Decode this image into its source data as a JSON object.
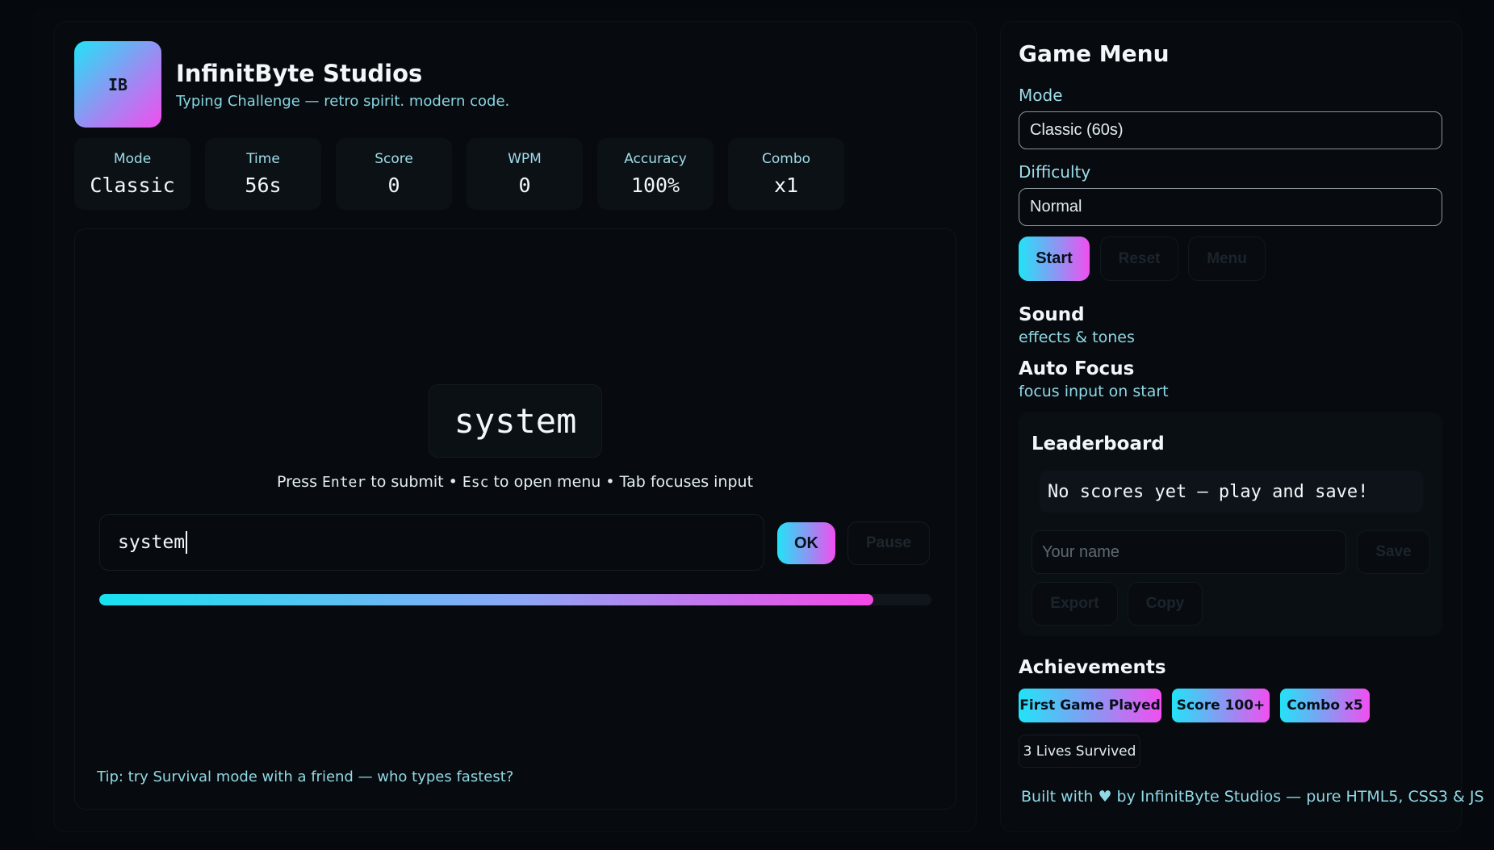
{
  "brand": {
    "logo_text": "IB",
    "title": "InfinitByte Studios",
    "subtitle": "Typing Challenge — retro spirit. modern code."
  },
  "stats": [
    {
      "label": "Mode",
      "value": "Classic"
    },
    {
      "label": "Time",
      "value": "56s"
    },
    {
      "label": "Score",
      "value": "0"
    },
    {
      "label": "WPM",
      "value": "0"
    },
    {
      "label": "Accuracy",
      "value": "100%"
    },
    {
      "label": "Combo",
      "value": "x1"
    }
  ],
  "game": {
    "current_word": "system",
    "hint": {
      "press": "Press",
      "enter_key": "Enter",
      "submit": "to submit •",
      "esc_key": "Esc",
      "menu": "to open menu • Tab focuses input"
    },
    "input_value": "system",
    "ok_label": "OK",
    "pause_label": "Pause",
    "time_progress": 0.93,
    "tip": "Tip: try Survival mode with a friend — who types fastest?"
  },
  "menu": {
    "title": "Game Menu",
    "mode_label": "Mode",
    "mode_value": "Classic (60s)",
    "difficulty_label": "Difficulty",
    "difficulty_value": "Normal",
    "start_label": "Start",
    "reset_label": "Reset",
    "menu_label": "Menu",
    "sound_title": "Sound",
    "sound_sub": "effects & tones",
    "autofocus_title": "Auto Focus",
    "autofocus_sub": "focus input on start"
  },
  "leaderboard": {
    "title": "Leaderboard",
    "empty_text": "No scores yet — play and save!",
    "name_placeholder": "Your name",
    "save_label": "Save",
    "export_label": "Export",
    "copy_label": "Copy"
  },
  "achievements": {
    "title": "Achievements",
    "badges": [
      "First Game Played",
      "Score 100+",
      "Combo x5"
    ],
    "plain_badge": "3 Lives Survived"
  },
  "footer": "Built with ♥ by InfinitByte Studios — pure HTML5, CSS3 & JS",
  "colors": {
    "accent_cyan": "#22e3f7",
    "accent_magenta": "#f24ef0",
    "background": "#05080c"
  }
}
